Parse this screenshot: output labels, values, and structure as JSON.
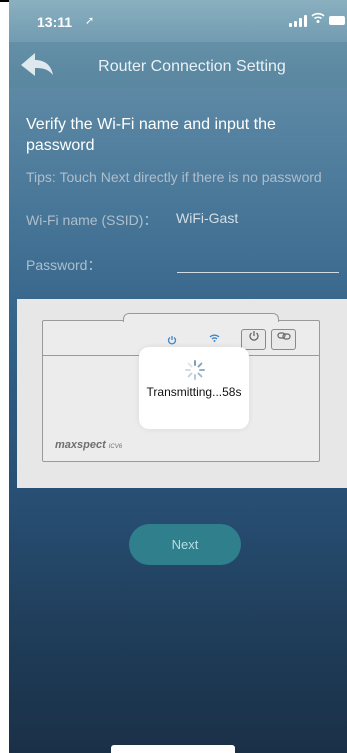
{
  "status_bar": {
    "time": "13:11",
    "location_icon": "location-arrow-icon",
    "signal_icon": "cellular-signal-icon",
    "wifi_icon": "wifi-icon",
    "battery_icon": "battery-icon"
  },
  "nav": {
    "title": "Router Connection Setting",
    "back_icon": "back-arrow-icon"
  },
  "form": {
    "heading": "Verify the Wi-Fi name and input the password",
    "tips": "Tips: Touch Next directly if there is no password",
    "ssid_label": "Wi-Fi name (SSID)：",
    "ssid_value": "WiFi-Gast",
    "password_label": "Password：",
    "password_value": ""
  },
  "device": {
    "brand": "maxspect",
    "brand_sub": "ICV6",
    "power_icon": "power-icon",
    "wifi_led_icon": "wifi-icon",
    "button_power_icon": "power-icon",
    "button_link_icon": "link-icon"
  },
  "progress_toast": {
    "spinner_icon": "spinner-icon",
    "text": "Transmitting...58s"
  },
  "actions": {
    "next_label": "Next"
  },
  "colors": {
    "accent_button": "#2f7f8c",
    "led_blue": "#3f86c8"
  }
}
